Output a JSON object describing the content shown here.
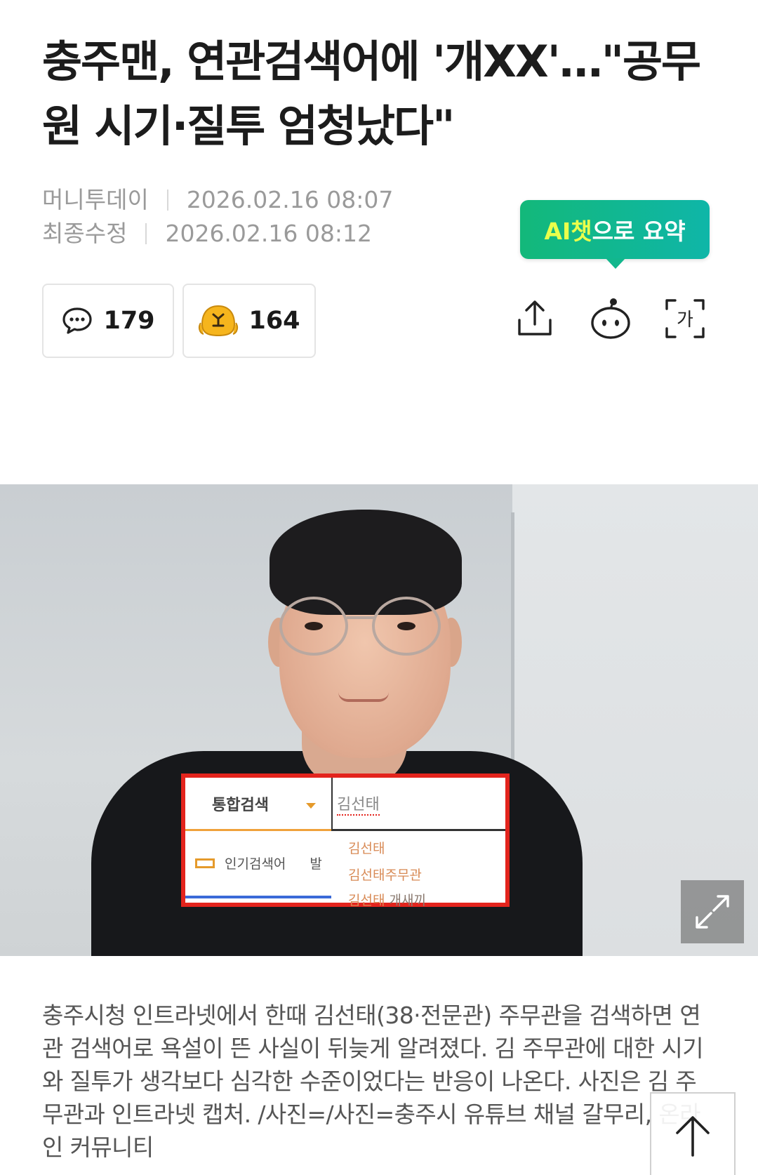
{
  "article": {
    "headline": "충주맨, 연관검색어에 '개XX'…\"공무원 시기·질투 엄청났다\"",
    "source": "머니투데이",
    "published": "2026.02.16 08:07",
    "modified_label": "최종수정",
    "modified": "2026.02.16 08:12"
  },
  "ai_summary": {
    "label_highlight": "AI챗",
    "label_rest": "으로 요약",
    "color_start": "#13b87a",
    "color_end": "#0fb6a8",
    "highlight_color": "#eaff4b"
  },
  "reactions": {
    "comment_icon": "speech-bubble-icon",
    "comment_count": "179",
    "reaction_icon": "angry-face-icon",
    "reaction_count": "164"
  },
  "toolbar": {
    "share_icon": "share-icon",
    "bot_icon": "chatbot-icon",
    "font_icon": "font-size-icon",
    "font_icon_glyph": "가"
  },
  "photo": {
    "search_box": {
      "category": "통합검색",
      "query": "김선태",
      "popular_label": "인기검색어",
      "popular_extra": "발",
      "suggestions": [
        {
          "main": "김선태",
          "extra": ""
        },
        {
          "main": "김선태주무관",
          "extra": ""
        },
        {
          "main": "김선태",
          "extra": "개새끼"
        }
      ],
      "border_color": "#e3241d"
    },
    "expand_icon": "expand-arrows-icon"
  },
  "caption": "충주시청 인트라넷에서 한때 김선태(38·전문관) 주무관을 검색하면 연관 검색어로 욕설이 뜬 사실이 뒤늦게 알려졌다. 김 주무관에 대한 시기와 질투가 생각보다 심각한 수준이었다는 반응이 나온다. 사진은 김 주무관과 인트라넷 캡처. /사진=/사진=충주시 유튜브 채널 갈무리, 온라인 커뮤니티",
  "scroll_top_icon": "arrow-up-icon"
}
